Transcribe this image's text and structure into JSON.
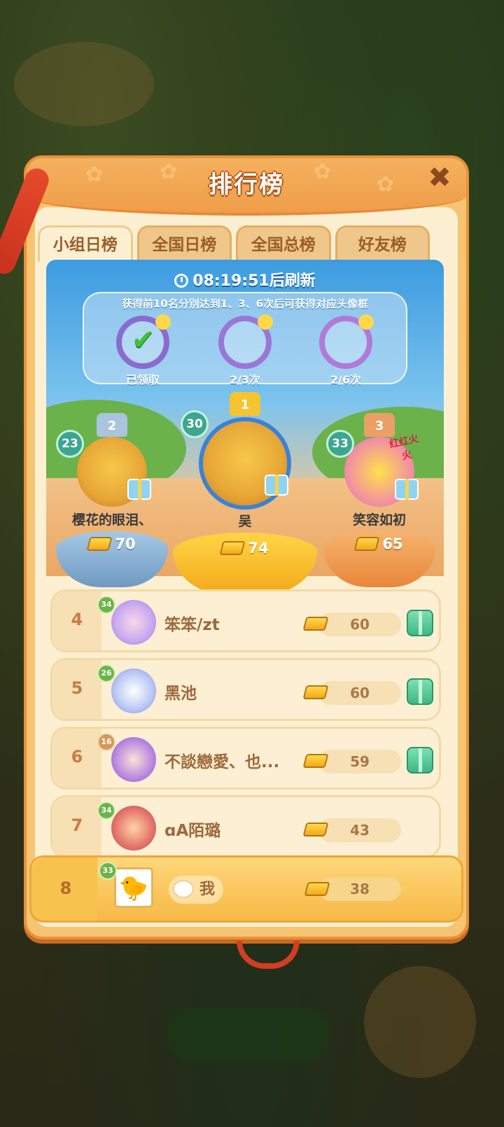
{
  "panel": {
    "title": "排行榜",
    "close_label": "✖"
  },
  "tabs": [
    {
      "label": "小组日榜",
      "active": true
    },
    {
      "label": "全国日榜",
      "active": false
    },
    {
      "label": "全国总榜",
      "active": false
    },
    {
      "label": "好友榜",
      "active": false
    }
  ],
  "refresh": {
    "time": "08:19:51",
    "suffix": "后刷新"
  },
  "rewards": {
    "hint": "获得前10名分别达到1、3、6次后可获得对应头像框",
    "frames": [
      {
        "label": "已领取"
      },
      {
        "label": "2/3次"
      },
      {
        "label": "2/6次"
      }
    ]
  },
  "podium": [
    {
      "rank": "2",
      "level": "23",
      "name": "樱花的眼泪、",
      "score": "70"
    },
    {
      "rank": "1",
      "level": "30",
      "name": "吴",
      "score": "74"
    },
    {
      "rank": "3",
      "level": "33",
      "name": "笑容如初",
      "score": "65"
    }
  ],
  "podium_badge_text": "红红火火",
  "rows": [
    {
      "rank": "4",
      "level": "34",
      "name": "笨笨/zt",
      "score": "60"
    },
    {
      "rank": "5",
      "level": "26",
      "name": "黑池",
      "score": "60"
    },
    {
      "rank": "6",
      "level": "16",
      "name": "不談戀愛、也...",
      "score": "59"
    },
    {
      "rank": "7",
      "level": "34",
      "name": "ɑA陌璐",
      "score": "43"
    }
  ],
  "me": {
    "rank": "8",
    "level": "33",
    "name": "我",
    "score": "38"
  }
}
